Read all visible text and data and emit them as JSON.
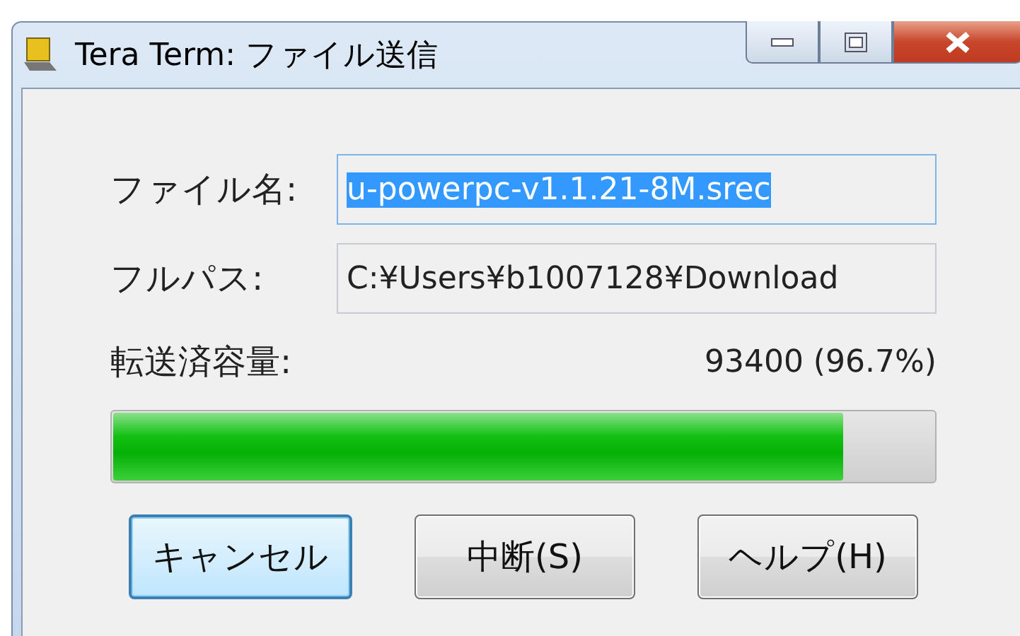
{
  "window": {
    "title": "Tera Term: ファイル送信"
  },
  "fields": [
    {
      "label": "ファイル名:",
      "value": "u-powerpc-v1.1.21-8M.srec",
      "selected": true
    },
    {
      "label": "フルパス:",
      "value": "C:¥Users¥b1007128¥Download",
      "selected": false
    }
  ],
  "transfer": {
    "label": "転送済容量:",
    "reading": "93400 (96.7%)"
  },
  "progress": {
    "level": 0.89
  },
  "buttons": [
    {
      "label": "キャンセル",
      "default": true
    },
    {
      "label": "中断(S)",
      "default": false
    },
    {
      "label": "ヘルプ(H)",
      "default": false
    }
  ]
}
